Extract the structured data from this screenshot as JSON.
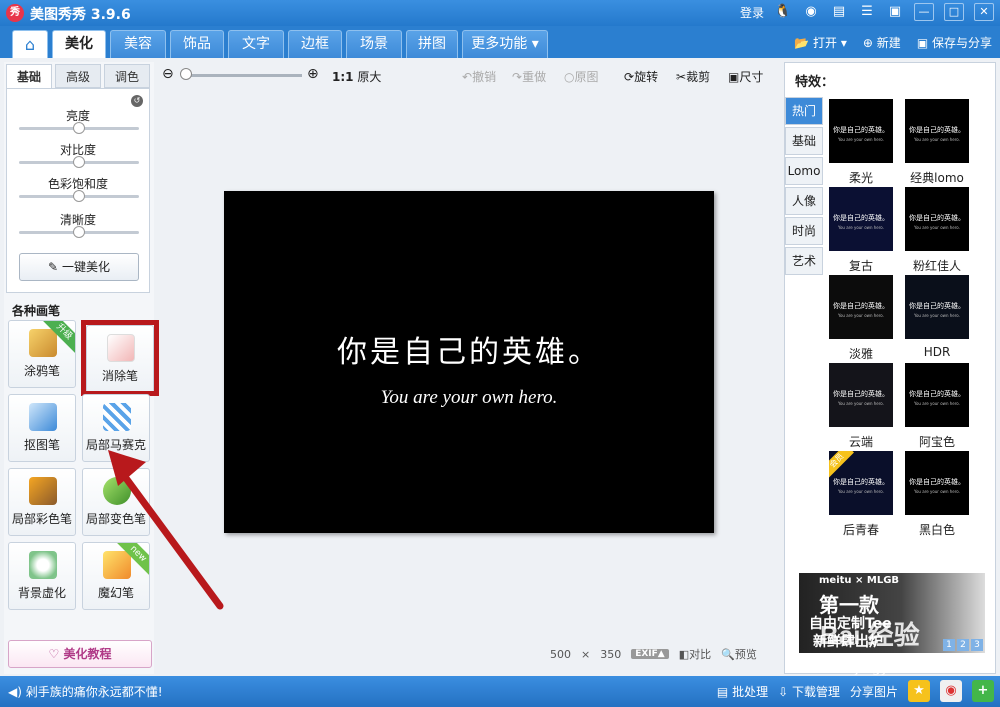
{
  "window": {
    "app_title": "美图秀秀 3.9.6",
    "login": "登录"
  },
  "tabs": [
    {
      "label": "美化"
    },
    {
      "label": "美容"
    },
    {
      "label": "饰品"
    },
    {
      "label": "文字"
    },
    {
      "label": "边框"
    },
    {
      "label": "场景"
    },
    {
      "label": "拼图"
    },
    {
      "label": "更多功能 ▾"
    }
  ],
  "file_tools": {
    "open": "打开",
    "new": "新建",
    "save_share": "保存与分享"
  },
  "left_panel": {
    "subtabs": [
      "基础",
      "高级",
      "调色"
    ],
    "sliders": [
      {
        "label": "亮度",
        "value": 0.5
      },
      {
        "label": "对比度",
        "value": 0.5
      },
      {
        "label": "色彩饱和度",
        "value": 0.5
      },
      {
        "label": "清晰度",
        "value": 0.5
      }
    ],
    "one_click": "一键美化",
    "brushes_title": "各种画笔",
    "brushes": [
      {
        "label": "涂鸦笔",
        "ribbon": "升级"
      },
      {
        "label": "消除笔",
        "ribbon": ""
      },
      {
        "label": "抠图笔",
        "ribbon": ""
      },
      {
        "label": "局部马赛克",
        "ribbon": ""
      },
      {
        "label": "局部彩色笔",
        "ribbon": ""
      },
      {
        "label": "局部变色笔",
        "ribbon": ""
      },
      {
        "label": "背景虚化",
        "ribbon": ""
      },
      {
        "label": "魔幻笔",
        "ribbon": "new"
      }
    ],
    "tutorial": "美化教程"
  },
  "toolbar": {
    "ratio": "1:1",
    "original_size": "原大",
    "undo": "撤销",
    "redo": "重做",
    "original": "原图",
    "rotate": "旋转",
    "crop": "裁剪",
    "size": "尺寸"
  },
  "canvas": {
    "text_cn": "你是自己的英雄。",
    "text_en": "You are your own hero.",
    "width": "500",
    "times": "×",
    "height": "350",
    "exif": "EXIF▲",
    "compare": "对比",
    "preview": "预览"
  },
  "effects": {
    "title": "特效：",
    "categories": [
      "热门",
      "基础",
      "Lomo",
      "人像",
      "时尚",
      "艺术"
    ],
    "items": [
      {
        "label": "柔光",
        "badge": ""
      },
      {
        "label": "经典lomo",
        "badge": ""
      },
      {
        "label": "复古",
        "badge": ""
      },
      {
        "label": "粉红佳人",
        "badge": ""
      },
      {
        "label": "淡雅",
        "badge": ""
      },
      {
        "label": "HDR",
        "badge": ""
      },
      {
        "label": "云端",
        "badge": ""
      },
      {
        "label": "阿宝色",
        "badge": ""
      },
      {
        "label": "后青春",
        "badge": "会员"
      },
      {
        "label": "黑白色",
        "badge": ""
      }
    ],
    "thumb_cn": "你是自己的英雄。",
    "thumb_en": "You are your own hero.",
    "ad": {
      "brand": "meitu × MLGB",
      "line1": "第一款",
      "line2": "自由定制Tee",
      "line3": "新鲜肆出炉",
      "pages": [
        "1",
        "2",
        "3"
      ]
    }
  },
  "watermark": {
    "logo": "Bai 经验",
    "url": "jingyan.baidu.com"
  },
  "statusbar": {
    "message": "◀) 剁手族的痛你永远都不懂!",
    "batch": "批处理",
    "download_mgr": "下载管理",
    "share_pic": "分享图片"
  },
  "colors": {
    "accent": "#2b7fd0",
    "highlight_red": "#b8191c"
  }
}
